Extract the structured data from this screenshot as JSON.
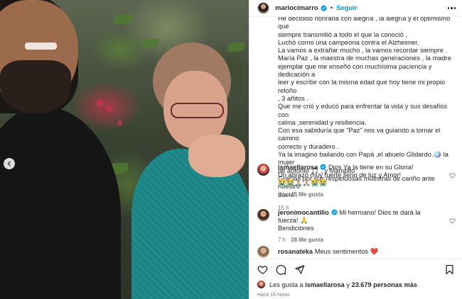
{
  "post": {
    "author": "mariocimarro",
    "follow_label": "Seguir",
    "separator": "•",
    "caption_lines": [
      "He decidido honrarla con alegría , la alegría y el optimismo que",
      "siempre transmitió a todo el que la conoció .",
      "Luchó como una campeona contra el Alzheimer.",
      "La vamos a extrañar mucho , la vamos recordar siempre .",
      "María Paz , la maestra de muchas generaciones , la madre",
      "ejemplar que me enseñó con muchísima paciencia y dedicación a",
      "leer y escribir con la misma edad que hoy tiene mi propio retoño",
      ", 3 añitos .",
      "Que me crió y educó para enfrentar la vida y sus desafíos con",
      "calma ,serenidad y resiliencia.",
      "Con esa sabiduría que \"Paz\" nos va guiando a tomar el camino",
      "correcto y duradero .",
      "Ya la imagino bailando con Papá ,el abuelo Glidardo.🪩 la mujer",
      "de antonio 🎵 ..y Mambito",
      "Gracias por sus respetuosas muestras de cariño ante nuestro",
      "duelo ."
    ],
    "caption_time": "15 h"
  },
  "comments": [
    {
      "username": "ismaellarosa",
      "text_lines": [
        "Dios Ya la tiene en su Gloria!",
        "Un abrazo muy fuerte lleno de luz y Amor!",
        "😭😭🙏🏼🙏🏼😭😭"
      ],
      "time": "9 h",
      "likes": "45 Me gusta",
      "verified": true
    },
    {
      "username": "jeronimocantillo",
      "text_lines": [
        "Mi hermano! Dios te dará la fuerza! 🙏",
        "Bendiciones"
      ],
      "time": "7 h",
      "likes": "38 Me gusta",
      "verified": true
    },
    {
      "username": "rosanateka",
      "text_lines": [
        "Meus sentimentos ❤️"
      ],
      "time": "",
      "likes": "",
      "verified": false
    }
  ],
  "likes_summary": {
    "prefix": "Les gusta a",
    "user": "ismaellarosa",
    "connector": "y",
    "count": "23.679 personas más"
  },
  "posted_ago": "Hace 15 horas",
  "colors": {
    "accent": "#0095f6",
    "verified": "#0095f6",
    "text": "#262626",
    "muted": "#737373",
    "like_red": "#ed1d24"
  },
  "icons": {
    "like": "heart-icon",
    "comment": "comment-bubble-icon",
    "share": "paper-plane-icon",
    "save": "bookmark-icon",
    "prev": "chevron-left-icon",
    "more": "more-horizontal-icon",
    "verified": "verified-badge-icon"
  }
}
